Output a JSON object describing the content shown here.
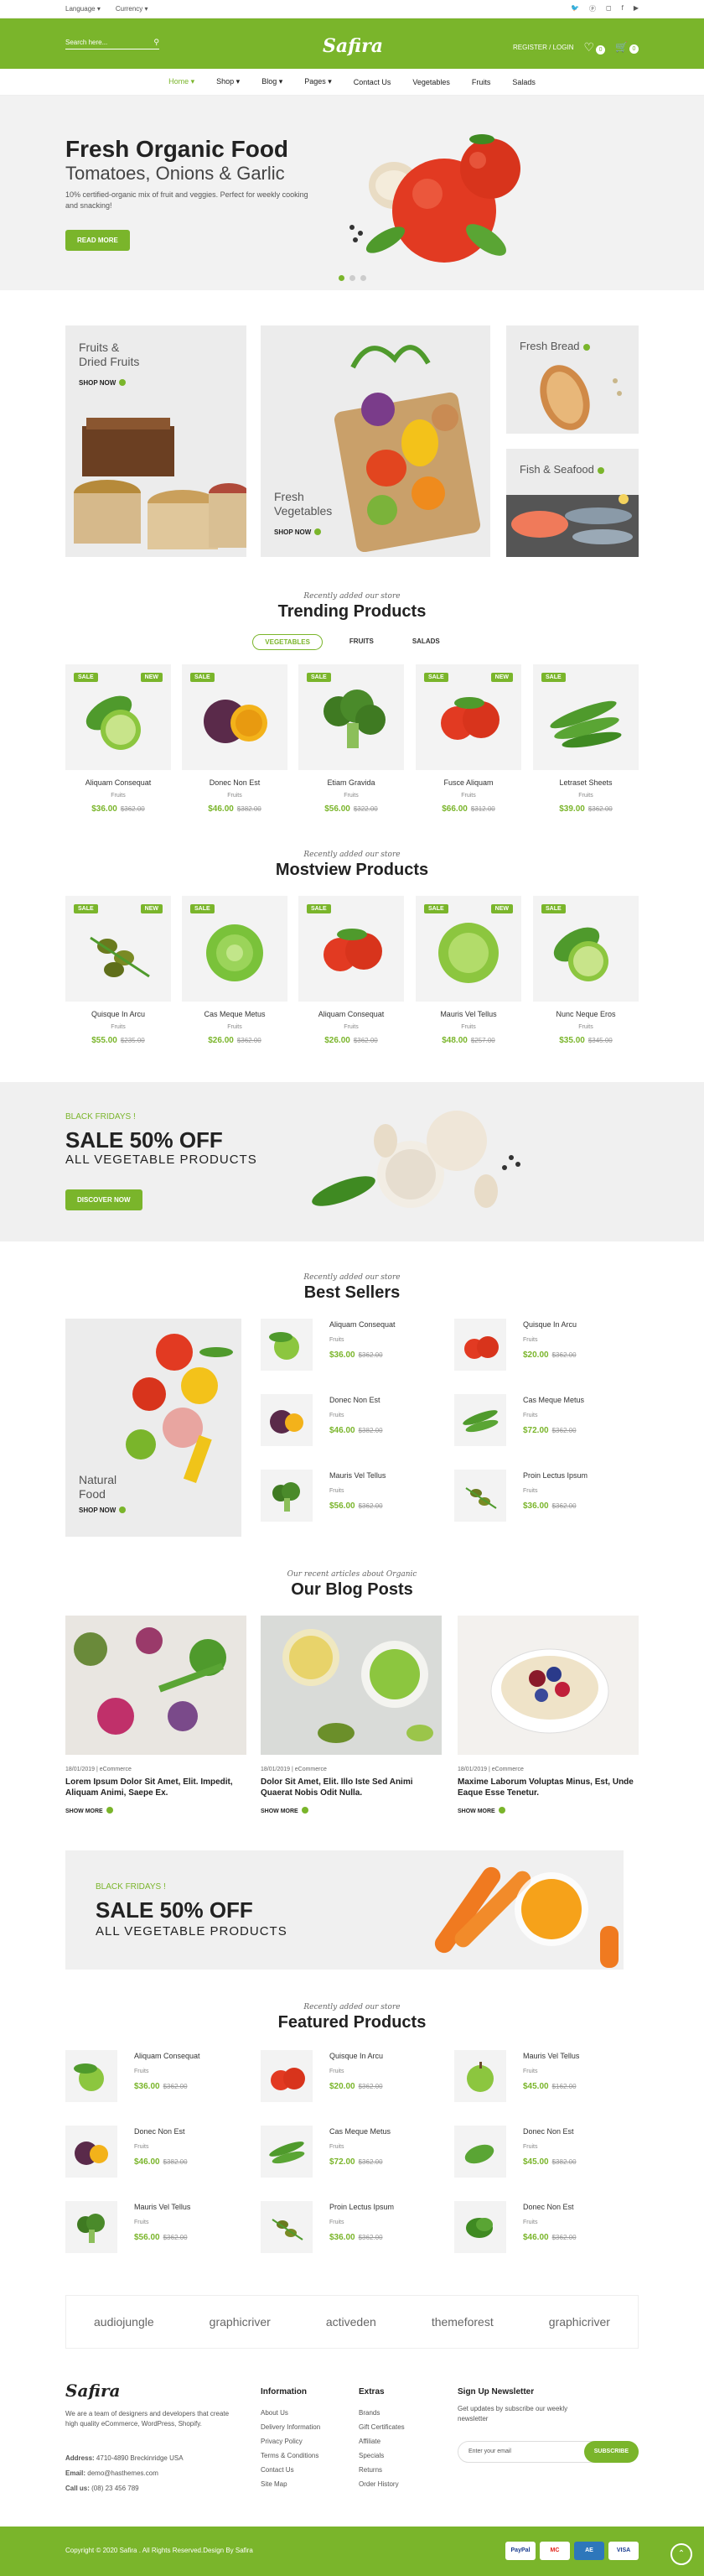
{
  "topbar": {
    "language": "Language",
    "currency": "Currency",
    "social": [
      "twitter-icon",
      "pinterest-icon",
      "instagram-icon",
      "facebook-icon",
      "youtube-icon"
    ]
  },
  "header": {
    "search_placeholder": "Search here...",
    "logo": "Safira",
    "register_login": "REGISTER / LOGIN",
    "wishlist_count": "0",
    "cart_count": "0"
  },
  "nav": [
    "Home",
    "Shop",
    "Blog",
    "Pages",
    "Contact Us",
    "Vegetables",
    "Fruits",
    "Salads"
  ],
  "hero": {
    "title": "Fresh Organic Food",
    "subtitle": "Tomatoes, Onions & Garlic",
    "text": "10% certified-organic mix of fruit and veggies. Perfect for weekly cooking and snacking!",
    "button": "READ MORE"
  },
  "categories": [
    {
      "title": "Fruits &\nDried Fruits",
      "link": "SHOP NOW"
    },
    {
      "title": "Fresh\nVegetables",
      "link": "SHOP NOW"
    },
    {
      "title": "Fresh Bread",
      "link": ""
    },
    {
      "title": "Fish & Seafood",
      "link": ""
    }
  ],
  "trending": {
    "sub": "Recently added our store",
    "title": "Trending Products",
    "tabs": [
      "VEGETABLES",
      "FRUITS",
      "SALADS"
    ],
    "items": [
      {
        "name": "Aliquam Consequat",
        "cat": "Fruits",
        "price": "$36.00",
        "old": "$362.00",
        "sale": "SALE",
        "new": "NEW"
      },
      {
        "name": "Donec Non Est",
        "cat": "Fruits",
        "price": "$46.00",
        "old": "$382.00",
        "sale": "SALE",
        "new": ""
      },
      {
        "name": "Etiam Gravida",
        "cat": "Fruits",
        "price": "$56.00",
        "old": "$322.00",
        "sale": "SALE",
        "new": ""
      },
      {
        "name": "Fusce Aliquam",
        "cat": "Fruits",
        "price": "$66.00",
        "old": "$312.00",
        "sale": "SALE",
        "new": "NEW"
      },
      {
        "name": "Letraset Sheets",
        "cat": "Fruits",
        "price": "$39.00",
        "old": "$362.00",
        "sale": "SALE",
        "new": ""
      }
    ]
  },
  "mostview": {
    "sub": "Recently added our store",
    "title": "Mostview Products",
    "items": [
      {
        "name": "Quisque In Arcu",
        "cat": "Fruits",
        "price": "$55.00",
        "old": "$235.00",
        "sale": "SALE",
        "new": "NEW"
      },
      {
        "name": "Cas Meque Metus",
        "cat": "Fruits",
        "price": "$26.00",
        "old": "$362.00",
        "sale": "SALE",
        "new": ""
      },
      {
        "name": "Aliquam Consequat",
        "cat": "Fruits",
        "price": "$26.00",
        "old": "$362.00",
        "sale": "SALE",
        "new": ""
      },
      {
        "name": "Mauris Vel Tellus",
        "cat": "Fruits",
        "price": "$48.00",
        "old": "$257.00",
        "sale": "SALE",
        "new": "NEW"
      },
      {
        "name": "Nunc Neque Eros",
        "cat": "Fruits",
        "price": "$35.00",
        "old": "$345.00",
        "sale": "SALE",
        "new": ""
      }
    ]
  },
  "sale1": {
    "kicker": "BLACK FRIDAYS !",
    "big": "SALE 50% OFF",
    "small": "ALL VEGETABLE PRODUCTS",
    "button": "DISCOVER NOW"
  },
  "bestsellers": {
    "sub": "Recently added our store",
    "title": "Best Sellers",
    "banner_title": "Natural\nFood",
    "banner_link": "SHOP NOW",
    "items": [
      {
        "name": "Aliquam Consequat",
        "cat": "Fruits",
        "price": "$36.00",
        "old": "$362.00"
      },
      {
        "name": "Quisque In Arcu",
        "cat": "Fruits",
        "price": "$20.00",
        "old": "$362.00"
      },
      {
        "name": "Donec Non Est",
        "cat": "Fruits",
        "price": "$46.00",
        "old": "$382.00"
      },
      {
        "name": "Cas Meque Metus",
        "cat": "Fruits",
        "price": "$72.00",
        "old": "$362.00"
      },
      {
        "name": "Mauris Vel Tellus",
        "cat": "Fruits",
        "price": "$56.00",
        "old": "$362.00"
      },
      {
        "name": "Proin Lectus Ipsum",
        "cat": "Fruits",
        "price": "$36.00",
        "old": "$362.00"
      }
    ]
  },
  "blog": {
    "sub": "Our recent articles about Organic",
    "title": "Our Blog Posts",
    "posts": [
      {
        "meta": "18/01/2019 | eCommerce",
        "title": "Lorem Ipsum Dolor Sit Amet, Elit. Impedit, Aliquam Animi, Saepe Ex.",
        "more": "SHOW MORE"
      },
      {
        "meta": "18/01/2019 | eCommerce",
        "title": "Dolor Sit Amet, Elit. Illo Iste Sed Animi Quaerat Nobis Odit Nulla.",
        "more": "SHOW MORE"
      },
      {
        "meta": "18/01/2019 | eCommerce",
        "title": "Maxime Laborum Voluptas Minus, Est, Unde Eaque Esse Tenetur.",
        "more": "SHOW MORE"
      }
    ]
  },
  "sale2": {
    "kicker": "BLACK FRIDAYS !",
    "big": "SALE 50% OFF",
    "small": "ALL VEGETABLE PRODUCTS"
  },
  "featured": {
    "sub": "Recently added our store",
    "title": "Featured Products",
    "items": [
      {
        "name": "Aliquam Consequat",
        "cat": "Fruits",
        "price": "$36.00",
        "old": "$362.00"
      },
      {
        "name": "Quisque In Arcu",
        "cat": "Fruits",
        "price": "$20.00",
        "old": "$362.00"
      },
      {
        "name": "Mauris Vel Tellus",
        "cat": "Fruits",
        "price": "$45.00",
        "old": "$162.00"
      },
      {
        "name": "Donec Non Est",
        "cat": "Fruits",
        "price": "$46.00",
        "old": "$382.00"
      },
      {
        "name": "Cas Meque Metus",
        "cat": "Fruits",
        "price": "$72.00",
        "old": "$362.00"
      },
      {
        "name": "Donec Non Est",
        "cat": "Fruits",
        "price": "$45.00",
        "old": "$382.00"
      },
      {
        "name": "Mauris Vel Tellus",
        "cat": "Fruits",
        "price": "$56.00",
        "old": "$362.00"
      },
      {
        "name": "Proin Lectus Ipsum",
        "cat": "Fruits",
        "price": "$36.00",
        "old": "$362.00"
      },
      {
        "name": "Donec Non Est",
        "cat": "Fruits",
        "price": "$46.00",
        "old": "$362.00"
      }
    ]
  },
  "brands": [
    "audiojungle",
    "graphicriver",
    "activeden",
    "themeforest",
    "graphicriver"
  ],
  "footer": {
    "logo": "Safira",
    "about": "We are a team of designers and developers that create high quality eCommerce, WordPress, Shopify.",
    "address_label": "Address:",
    "address": "4710-4890 Breckinridge USA",
    "email_label": "Email:",
    "email": "demo@hasthemes.com",
    "call_label": "Call us:",
    "call": "(08) 23 456 789",
    "info_title": "Information",
    "info": [
      "About Us",
      "Delivery Information",
      "Privacy Policy",
      "Terms & Conditions",
      "Contact Us",
      "Site Map"
    ],
    "extras_title": "Extras",
    "extras": [
      "Brands",
      "Gift Certificates",
      "Affiliate",
      "Specials",
      "Returns",
      "Order History"
    ],
    "news_title": "Sign Up Newsletter",
    "news_text": "Get updates by subscribe our weekly newsletter",
    "news_placeholder": "Enter your email",
    "news_button": "SUBSCRIBE",
    "copyright": "Copyright © 2020 Safira . All Rights Reserved.Design By Safira",
    "payments": [
      "PayPal",
      "MC",
      "AE",
      "VISA"
    ]
  }
}
